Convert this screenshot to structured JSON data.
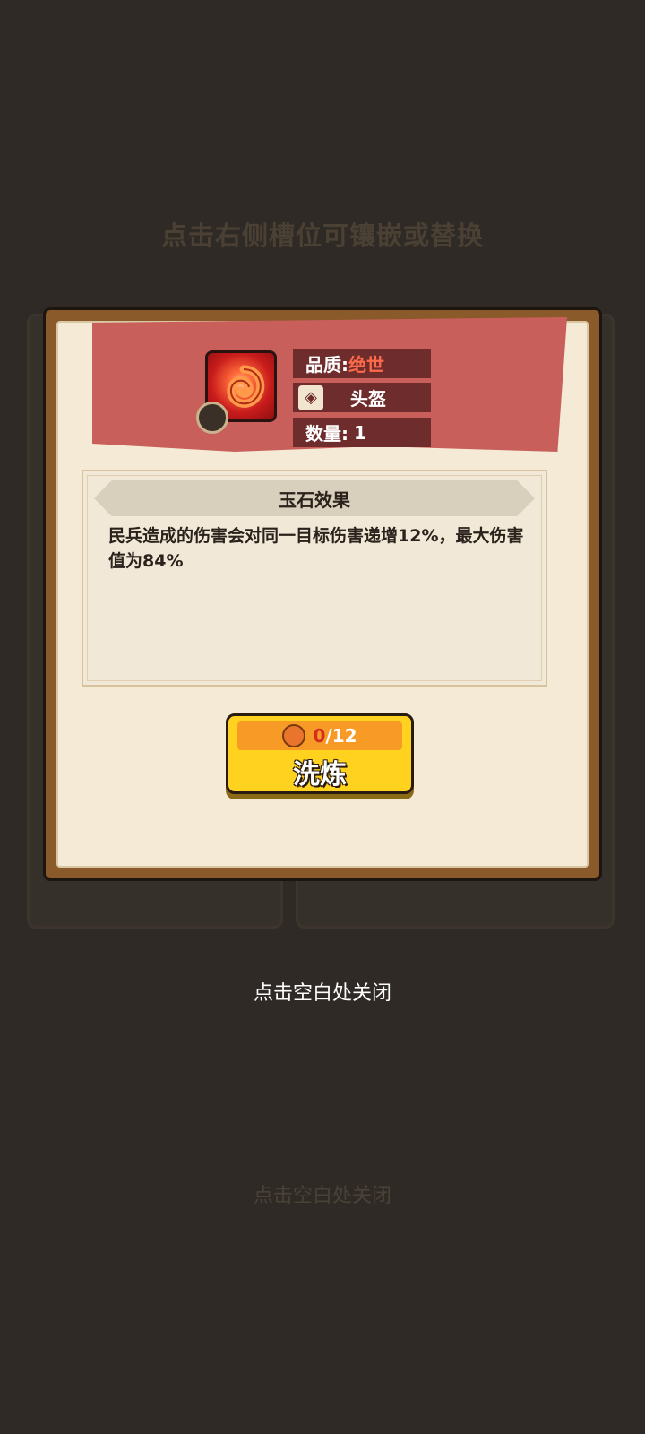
{
  "background": {
    "top_hint": "点击右侧槽位可镶嵌或替换",
    "bottom_hint": "点击空白处关闭"
  },
  "item": {
    "quality_label": "品质:",
    "quality_value": "绝世",
    "type": "头盔",
    "quantity_label": "数量:",
    "quantity_value": "1",
    "icon": "red-spiral-jade-icon"
  },
  "effect": {
    "title": "玉石效果",
    "description": "民兵造成的伤害会对同一目标伤害递增12%，最大伤害值为84%"
  },
  "refine_button": {
    "cost_current": "0",
    "cost_total": "/12",
    "label": "洗炼"
  },
  "close_hint": "点击空白处关闭",
  "colors": {
    "banner": "#c95f5b",
    "button": "#ffd21f",
    "quality": "#ff6a4a"
  }
}
